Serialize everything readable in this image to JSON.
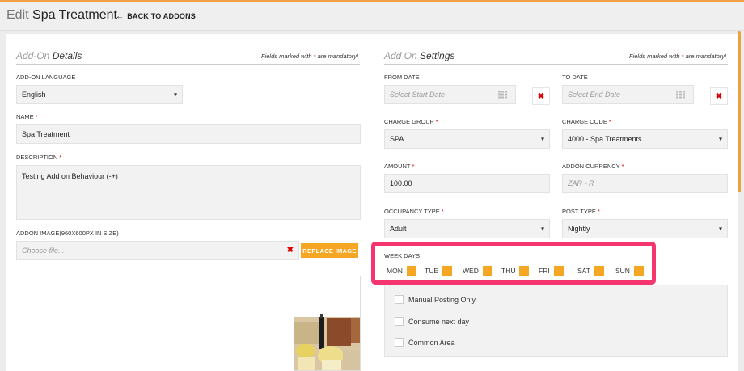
{
  "header": {
    "title_prefix": "Edit",
    "title": "Spa Treatment",
    "back_link": "BACK TO ADDONS"
  },
  "left": {
    "section_title_light": "Add-On",
    "section_title_bold": "Details",
    "mandatory_note_a": "Fields marked with",
    "mandatory_note_b": "are mandatory!",
    "language_label": "ADD-ON LANGUAGE",
    "language_value": "English",
    "name_label": "NAME",
    "name_value": "Spa Treatment",
    "description_label": "DESCRIPTION",
    "description_value": "Testing Add on Behaviour (-+)",
    "image_label": "ADDON IMAGE(960X600PX IN SIZE)",
    "image_placeholder": "Choose file...",
    "replace_button": "REPLACE IMAGE"
  },
  "right": {
    "section_title_light": "Add On",
    "section_title_bold": "Settings",
    "mandatory_note_a": "Fields marked with",
    "mandatory_note_b": "are mandatory!",
    "from_date_label": "FROM DATE",
    "from_date_placeholder": "Select Start Date",
    "to_date_label": "TO DATE",
    "to_date_placeholder": "Select End Date",
    "charge_group_label": "CHARGE GROUP",
    "charge_group_value": "SPA",
    "charge_code_label": "CHARGE CODE",
    "charge_code_value": "4000 - Spa Treatments",
    "amount_label": "AMOUNT",
    "amount_value": "100.00",
    "currency_label": "ADDON CURRENCY",
    "currency_placeholder": "ZAR - R",
    "occupancy_label": "OCCUPANCY TYPE",
    "occupancy_value": "Adult",
    "post_type_label": "POST TYPE",
    "post_type_value": "Nightly",
    "week_days_label": "WEEK DAYS",
    "week_days": [
      "MON",
      "TUE",
      "WED",
      "THU",
      "FRI",
      "SAT",
      "SUN"
    ],
    "checkboxes": [
      "Manual Posting Only",
      "Consume next day",
      "Common Area"
    ]
  },
  "colors": {
    "accent": "#f5a623",
    "highlight": "#f5356f",
    "required": "#dd0000"
  }
}
